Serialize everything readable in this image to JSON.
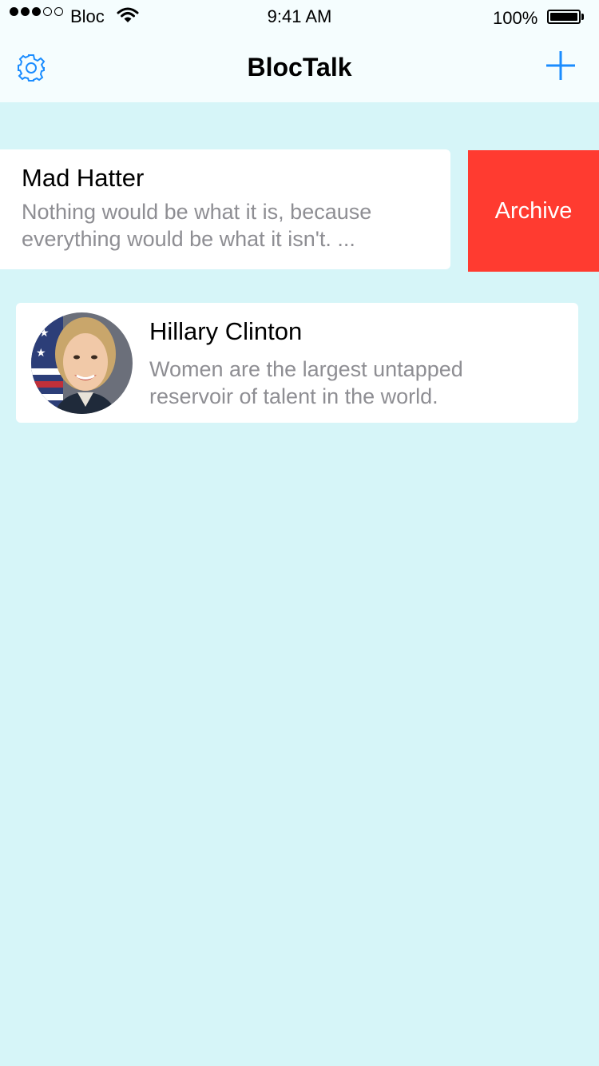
{
  "status_bar": {
    "carrier": "Bloc",
    "time": "9:41 AM",
    "battery": "100%"
  },
  "nav": {
    "title": "BlocTalk",
    "left_icon": "gear-icon",
    "right_icon": "plus-icon"
  },
  "conversations": [
    {
      "name": "Mad Hatter",
      "preview_line1": "Nothing would be what it is, because",
      "preview_line2": "everything would be what it isn't. ...",
      "swipe_action": "Archive"
    },
    {
      "name": "Hillary Clinton",
      "preview_line1": "Women are the largest untapped",
      "preview_line2": "reservoir of talent in the world."
    }
  ],
  "colors": {
    "background": "#d6f5f8",
    "accent": "#1a8cff",
    "archive": "#ff3b30",
    "preview_text": "#8e8e93"
  }
}
